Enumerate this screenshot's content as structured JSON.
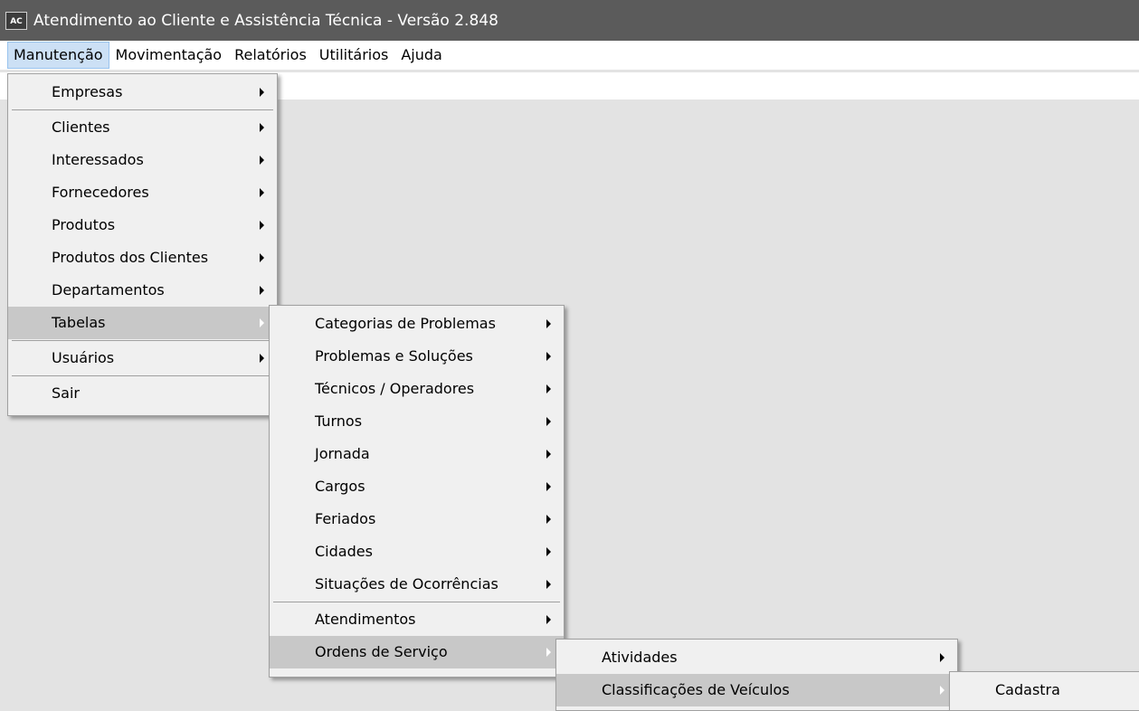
{
  "window": {
    "icon_text": "AC",
    "title": "Atendimento ao Cliente e Assistência Técnica - Versão 2.848"
  },
  "menubar": {
    "items": [
      {
        "label": "Manutenção"
      },
      {
        "label": "Movimentação"
      },
      {
        "label": "Relatórios"
      },
      {
        "label": "Utilitários"
      },
      {
        "label": "Ajuda"
      }
    ]
  },
  "menu_manutencao": {
    "items": [
      {
        "label": "Empresas"
      },
      {
        "label": "Clientes"
      },
      {
        "label": "Interessados"
      },
      {
        "label": "Fornecedores"
      },
      {
        "label": "Produtos"
      },
      {
        "label": "Produtos dos Clientes"
      },
      {
        "label": "Departamentos"
      },
      {
        "label": "Tabelas"
      },
      {
        "label": "Usuários"
      },
      {
        "label": "Sair"
      }
    ]
  },
  "menu_tabelas": {
    "items": [
      {
        "label": "Categorias de Problemas"
      },
      {
        "label": "Problemas e Soluções"
      },
      {
        "label": "Técnicos / Operadores"
      },
      {
        "label": "Turnos"
      },
      {
        "label": "Jornada"
      },
      {
        "label": "Cargos"
      },
      {
        "label": "Feriados"
      },
      {
        "label": "Cidades"
      },
      {
        "label": "Situações de Ocorrências"
      },
      {
        "label": "Atendimentos"
      },
      {
        "label": "Ordens de Serviço"
      }
    ]
  },
  "menu_ordens": {
    "items": [
      {
        "label": "Atividades"
      },
      {
        "label": "Classificações de Veículos"
      }
    ]
  },
  "menu_classificacoes": {
    "items": [
      {
        "label": "Cadastra"
      }
    ]
  }
}
